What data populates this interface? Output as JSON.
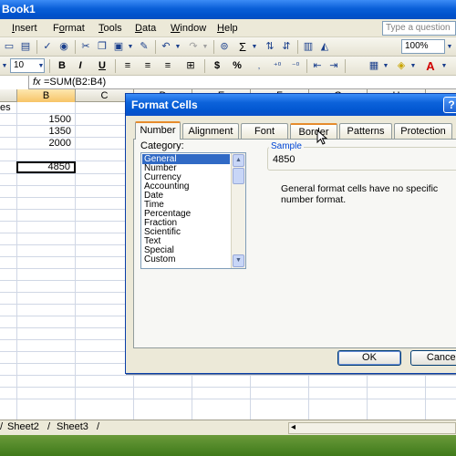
{
  "window": {
    "title": "Book1"
  },
  "menu": [
    {
      "label": "Insert",
      "u": "I",
      "rest": "nsert"
    },
    {
      "label": "Format",
      "u": "o",
      "pre": "F",
      "rest": "rmat"
    },
    {
      "label": "Tools",
      "u": "T",
      "rest": "ools"
    },
    {
      "label": "Data",
      "u": "D",
      "rest": "ata"
    },
    {
      "label": "Window",
      "u": "W",
      "rest": "indow"
    },
    {
      "label": "Help",
      "u": "H",
      "rest": "elp"
    }
  ],
  "help_search": {
    "placeholder": "Type a question"
  },
  "toolbar": {
    "zoom": "100%",
    "font_size": "10",
    "bold": "B",
    "italic": "I",
    "underline": "U",
    "currency": "$",
    "percent": "%",
    "sum": "Σ"
  },
  "formula_bar": {
    "fx": "fx",
    "formula": "=SUM(B2:B4)"
  },
  "columns": [
    "B",
    "C",
    "D",
    "E",
    "F",
    "G",
    "H"
  ],
  "cells": {
    "a1": "es",
    "b2": "1500",
    "b3": "1350",
    "b4": "2000",
    "b6": "4850"
  },
  "sheets": [
    "Sheet2",
    "Sheet3"
  ],
  "dialog": {
    "title": "Format Cells",
    "help": "?",
    "tabs": [
      "Number",
      "Alignment",
      "Font",
      "Border",
      "Patterns",
      "Protection"
    ],
    "active_tab": "Number",
    "category_label": "Category:",
    "categories": [
      "General",
      "Number",
      "Currency",
      "Accounting",
      "Date",
      "Time",
      "Percentage",
      "Fraction",
      "Scientific",
      "Text",
      "Special",
      "Custom"
    ],
    "selected_category": "General",
    "sample_label": "Sample",
    "sample_value": "4850",
    "description": "General format cells have no specific number format.",
    "ok": "OK",
    "cancel": "Cancel"
  }
}
